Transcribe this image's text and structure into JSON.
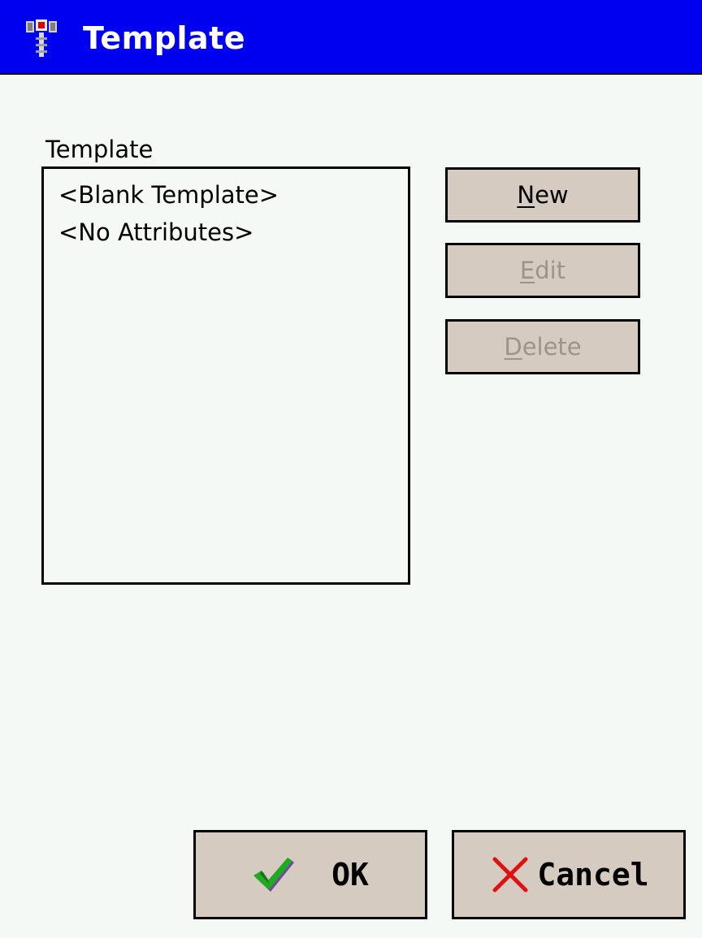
{
  "window": {
    "title": "Template",
    "icon": "app-icon"
  },
  "template_list": {
    "label": "Template",
    "items": [
      "<Blank Template>",
      "<No Attributes>"
    ]
  },
  "buttons": {
    "new": {
      "accel": "N",
      "rest": "ew",
      "enabled": true
    },
    "edit": {
      "accel": "E",
      "rest": "dit",
      "enabled": false
    },
    "delete": {
      "accel": "D",
      "rest": "elete",
      "enabled": false
    }
  },
  "footer": {
    "ok_label": "OK",
    "ok_icon": "checkmark-icon",
    "cancel_label": "Cancel",
    "cancel_icon": "close-x-icon"
  },
  "colors": {
    "titlebar": "#0000f0",
    "background": "#f5f9f5",
    "button_face": "#d6cbc0",
    "disabled_text": "#9a948e"
  }
}
